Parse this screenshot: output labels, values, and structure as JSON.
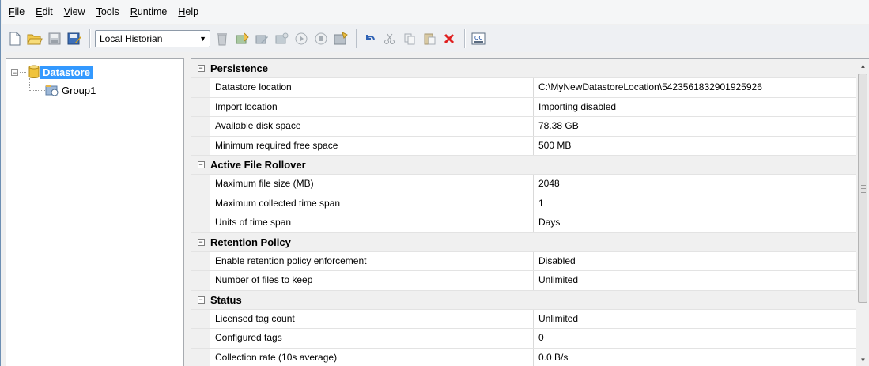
{
  "menubar": {
    "items": [
      {
        "u": "F",
        "rest": "ile"
      },
      {
        "u": "E",
        "rest": "dit"
      },
      {
        "u": "V",
        "rest": "iew"
      },
      {
        "u": "T",
        "rest": "ools"
      },
      {
        "u": "R",
        "rest": "untime"
      },
      {
        "u": "H",
        "rest": "elp"
      }
    ]
  },
  "toolbar": {
    "combo_value": "Local Historian"
  },
  "tree": {
    "root": "Datastore",
    "child": "Group1"
  },
  "grid": {
    "sections": [
      {
        "title": "Persistence",
        "rows": [
          {
            "name": "Datastore location",
            "value": "C:\\MyNewDatastoreLocation\\5423561832901925926"
          },
          {
            "name": "Import location",
            "value": "Importing disabled"
          },
          {
            "name": "Available disk space",
            "value": "78.38 GB"
          },
          {
            "name": "Minimum required free space",
            "value": "500 MB"
          }
        ]
      },
      {
        "title": "Active File Rollover",
        "rows": [
          {
            "name": "Maximum file size (MB)",
            "value": "2048"
          },
          {
            "name": "Maximum collected time span",
            "value": "1"
          },
          {
            "name": "Units of time span",
            "value": "Days"
          }
        ]
      },
      {
        "title": "Retention Policy",
        "rows": [
          {
            "name": "Enable retention policy enforcement",
            "value": "Disabled"
          },
          {
            "name": "Number of files to keep",
            "value": "Unlimited"
          }
        ]
      },
      {
        "title": "Status",
        "rows": [
          {
            "name": "Licensed tag count",
            "value": "Unlimited"
          },
          {
            "name": "Configured tags",
            "value": "0"
          },
          {
            "name": "Collection rate (10s average)",
            "value": "0.0 B/s"
          }
        ]
      }
    ]
  },
  "colors": {
    "selection": "#3399ff",
    "delete": "#e02020"
  }
}
